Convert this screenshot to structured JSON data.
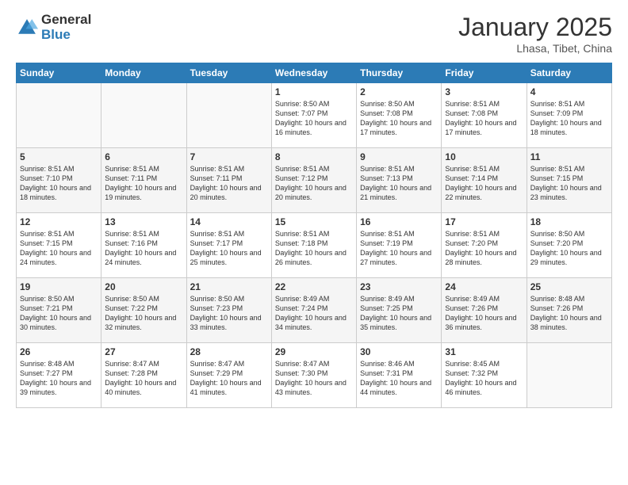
{
  "header": {
    "logo_general": "General",
    "logo_blue": "Blue",
    "month_title": "January 2025",
    "location": "Lhasa, Tibet, China"
  },
  "columns": [
    "Sunday",
    "Monday",
    "Tuesday",
    "Wednesday",
    "Thursday",
    "Friday",
    "Saturday"
  ],
  "weeks": [
    [
      {
        "day": "",
        "sunrise": "",
        "sunset": "",
        "daylight": ""
      },
      {
        "day": "",
        "sunrise": "",
        "sunset": "",
        "daylight": ""
      },
      {
        "day": "",
        "sunrise": "",
        "sunset": "",
        "daylight": ""
      },
      {
        "day": "1",
        "sunrise": "Sunrise: 8:50 AM",
        "sunset": "Sunset: 7:07 PM",
        "daylight": "Daylight: 10 hours and 16 minutes."
      },
      {
        "day": "2",
        "sunrise": "Sunrise: 8:50 AM",
        "sunset": "Sunset: 7:08 PM",
        "daylight": "Daylight: 10 hours and 17 minutes."
      },
      {
        "day": "3",
        "sunrise": "Sunrise: 8:51 AM",
        "sunset": "Sunset: 7:08 PM",
        "daylight": "Daylight: 10 hours and 17 minutes."
      },
      {
        "day": "4",
        "sunrise": "Sunrise: 8:51 AM",
        "sunset": "Sunset: 7:09 PM",
        "daylight": "Daylight: 10 hours and 18 minutes."
      }
    ],
    [
      {
        "day": "5",
        "sunrise": "Sunrise: 8:51 AM",
        "sunset": "Sunset: 7:10 PM",
        "daylight": "Daylight: 10 hours and 18 minutes."
      },
      {
        "day": "6",
        "sunrise": "Sunrise: 8:51 AM",
        "sunset": "Sunset: 7:11 PM",
        "daylight": "Daylight: 10 hours and 19 minutes."
      },
      {
        "day": "7",
        "sunrise": "Sunrise: 8:51 AM",
        "sunset": "Sunset: 7:11 PM",
        "daylight": "Daylight: 10 hours and 20 minutes."
      },
      {
        "day": "8",
        "sunrise": "Sunrise: 8:51 AM",
        "sunset": "Sunset: 7:12 PM",
        "daylight": "Daylight: 10 hours and 20 minutes."
      },
      {
        "day": "9",
        "sunrise": "Sunrise: 8:51 AM",
        "sunset": "Sunset: 7:13 PM",
        "daylight": "Daylight: 10 hours and 21 minutes."
      },
      {
        "day": "10",
        "sunrise": "Sunrise: 8:51 AM",
        "sunset": "Sunset: 7:14 PM",
        "daylight": "Daylight: 10 hours and 22 minutes."
      },
      {
        "day": "11",
        "sunrise": "Sunrise: 8:51 AM",
        "sunset": "Sunset: 7:15 PM",
        "daylight": "Daylight: 10 hours and 23 minutes."
      }
    ],
    [
      {
        "day": "12",
        "sunrise": "Sunrise: 8:51 AM",
        "sunset": "Sunset: 7:15 PM",
        "daylight": "Daylight: 10 hours and 24 minutes."
      },
      {
        "day": "13",
        "sunrise": "Sunrise: 8:51 AM",
        "sunset": "Sunset: 7:16 PM",
        "daylight": "Daylight: 10 hours and 24 minutes."
      },
      {
        "day": "14",
        "sunrise": "Sunrise: 8:51 AM",
        "sunset": "Sunset: 7:17 PM",
        "daylight": "Daylight: 10 hours and 25 minutes."
      },
      {
        "day": "15",
        "sunrise": "Sunrise: 8:51 AM",
        "sunset": "Sunset: 7:18 PM",
        "daylight": "Daylight: 10 hours and 26 minutes."
      },
      {
        "day": "16",
        "sunrise": "Sunrise: 8:51 AM",
        "sunset": "Sunset: 7:19 PM",
        "daylight": "Daylight: 10 hours and 27 minutes."
      },
      {
        "day": "17",
        "sunrise": "Sunrise: 8:51 AM",
        "sunset": "Sunset: 7:20 PM",
        "daylight": "Daylight: 10 hours and 28 minutes."
      },
      {
        "day": "18",
        "sunrise": "Sunrise: 8:50 AM",
        "sunset": "Sunset: 7:20 PM",
        "daylight": "Daylight: 10 hours and 29 minutes."
      }
    ],
    [
      {
        "day": "19",
        "sunrise": "Sunrise: 8:50 AM",
        "sunset": "Sunset: 7:21 PM",
        "daylight": "Daylight: 10 hours and 30 minutes."
      },
      {
        "day": "20",
        "sunrise": "Sunrise: 8:50 AM",
        "sunset": "Sunset: 7:22 PM",
        "daylight": "Daylight: 10 hours and 32 minutes."
      },
      {
        "day": "21",
        "sunrise": "Sunrise: 8:50 AM",
        "sunset": "Sunset: 7:23 PM",
        "daylight": "Daylight: 10 hours and 33 minutes."
      },
      {
        "day": "22",
        "sunrise": "Sunrise: 8:49 AM",
        "sunset": "Sunset: 7:24 PM",
        "daylight": "Daylight: 10 hours and 34 minutes."
      },
      {
        "day": "23",
        "sunrise": "Sunrise: 8:49 AM",
        "sunset": "Sunset: 7:25 PM",
        "daylight": "Daylight: 10 hours and 35 minutes."
      },
      {
        "day": "24",
        "sunrise": "Sunrise: 8:49 AM",
        "sunset": "Sunset: 7:26 PM",
        "daylight": "Daylight: 10 hours and 36 minutes."
      },
      {
        "day": "25",
        "sunrise": "Sunrise: 8:48 AM",
        "sunset": "Sunset: 7:26 PM",
        "daylight": "Daylight: 10 hours and 38 minutes."
      }
    ],
    [
      {
        "day": "26",
        "sunrise": "Sunrise: 8:48 AM",
        "sunset": "Sunset: 7:27 PM",
        "daylight": "Daylight: 10 hours and 39 minutes."
      },
      {
        "day": "27",
        "sunrise": "Sunrise: 8:47 AM",
        "sunset": "Sunset: 7:28 PM",
        "daylight": "Daylight: 10 hours and 40 minutes."
      },
      {
        "day": "28",
        "sunrise": "Sunrise: 8:47 AM",
        "sunset": "Sunset: 7:29 PM",
        "daylight": "Daylight: 10 hours and 41 minutes."
      },
      {
        "day": "29",
        "sunrise": "Sunrise: 8:47 AM",
        "sunset": "Sunset: 7:30 PM",
        "daylight": "Daylight: 10 hours and 43 minutes."
      },
      {
        "day": "30",
        "sunrise": "Sunrise: 8:46 AM",
        "sunset": "Sunset: 7:31 PM",
        "daylight": "Daylight: 10 hours and 44 minutes."
      },
      {
        "day": "31",
        "sunrise": "Sunrise: 8:45 AM",
        "sunset": "Sunset: 7:32 PM",
        "daylight": "Daylight: 10 hours and 46 minutes."
      },
      {
        "day": "",
        "sunrise": "",
        "sunset": "",
        "daylight": ""
      }
    ]
  ]
}
